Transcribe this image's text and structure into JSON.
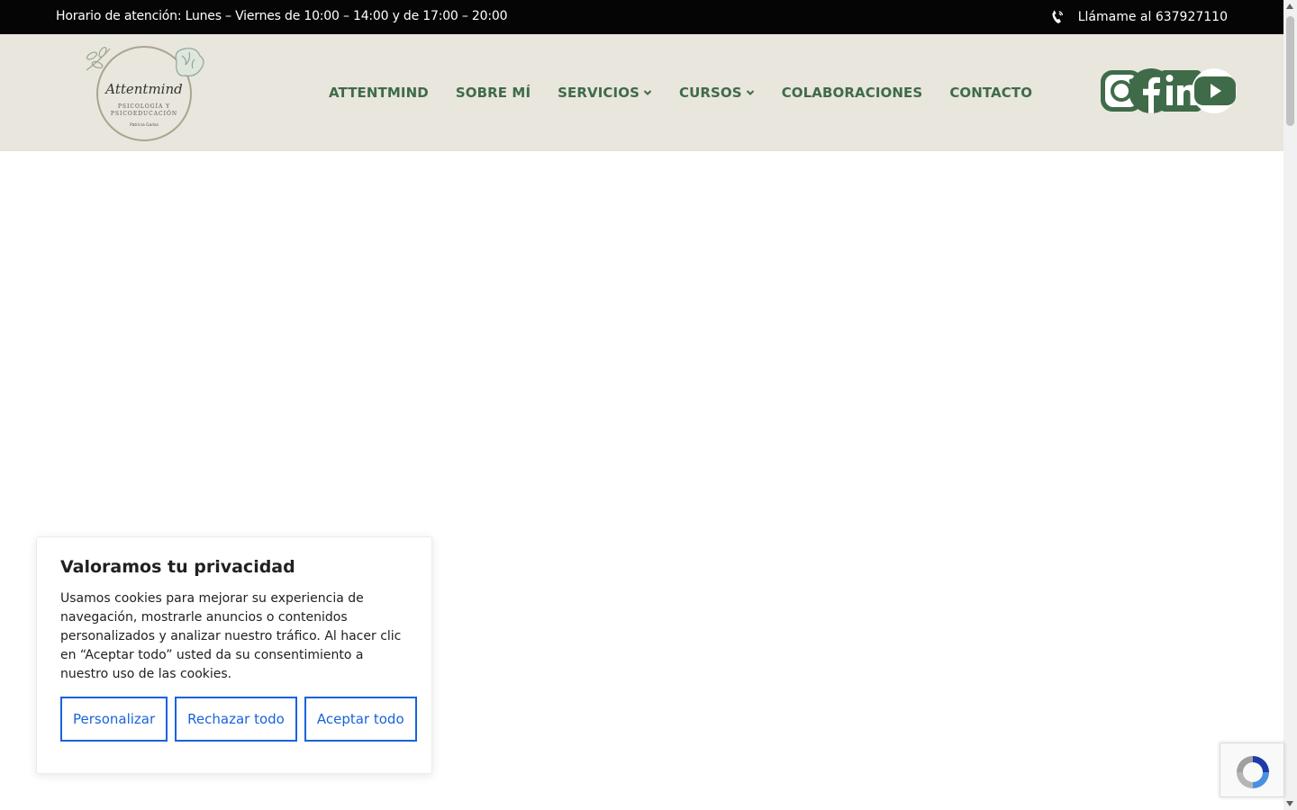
{
  "topbar": {
    "hours": "Horario de atención: Lunes – Viernes de 10:00 – 14:00 y de 17:00 – 20:00",
    "phone": "Llámame al 637927110",
    "phone_icon": "phone-ringing-icon"
  },
  "logo": {
    "name": "Attentmind",
    "tagline_1": "PSICOLOGÍA Y",
    "tagline_2": "PSICOEDUCACIÓN",
    "author": "Patricia Garba"
  },
  "nav": {
    "items": [
      {
        "label": "ATTENTMIND"
      },
      {
        "label": "SOBRE MÍ"
      },
      {
        "label": "SERVICIOS"
      },
      {
        "label": "CURSOS"
      },
      {
        "label": "COLABORACIONES"
      },
      {
        "label": "CONTACTO"
      }
    ]
  },
  "social": {
    "icons": [
      "instagram-icon",
      "facebook-icon",
      "linkedin-icon",
      "youtube-icon"
    ]
  },
  "cookie": {
    "title": "Valoramos tu privacidad",
    "text": "Usamos cookies para mejorar su experiencia de navegación, mostrarle anuncios o contenidos personalizados y analizar nuestro tráfico. Al hacer clic en “Aceptar todo” usted da su consentimiento a nuestro uso de las cookies.",
    "customize": "Personalizar",
    "reject": "Rechazar todo",
    "accept": "Aceptar todo"
  },
  "colors": {
    "brand_green": "#3f6b49",
    "header_bg": "#e8e6dd",
    "topbar_bg": "#050505",
    "cookie_button": "#1863dc"
  }
}
